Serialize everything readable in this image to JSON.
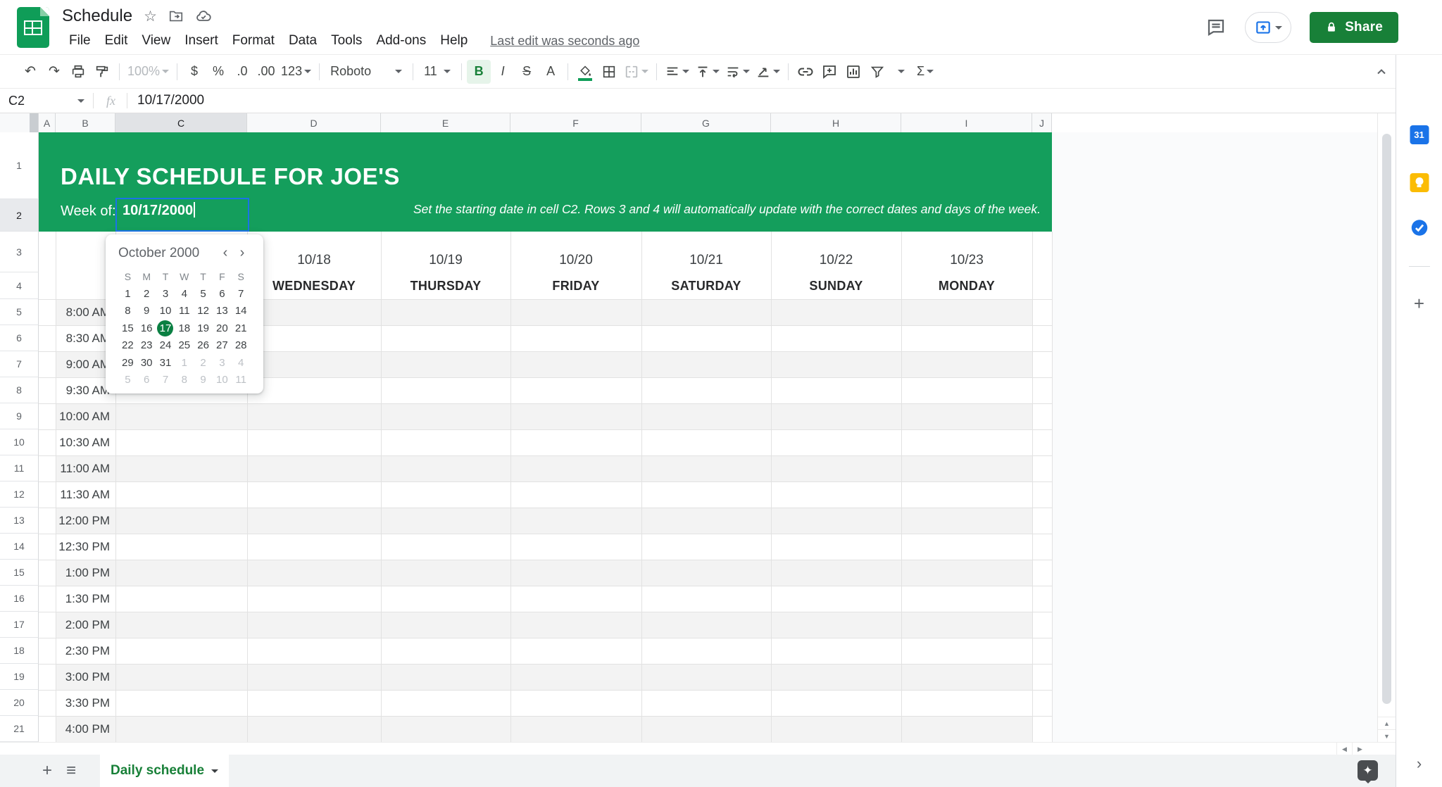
{
  "titlebar": {
    "doc_title": "Schedule",
    "menus": [
      "File",
      "Edit",
      "View",
      "Insert",
      "Format",
      "Data",
      "Tools",
      "Add-ons",
      "Help"
    ],
    "last_edit": "Last edit was seconds ago",
    "share_label": "Share"
  },
  "toolbar": {
    "zoom": "100%",
    "currency": "$",
    "percent": "%",
    "decimal_decrease": ".0",
    "decimal_increase": ".00",
    "number_format": "123",
    "font_name": "Roboto",
    "font_size": "11",
    "bold": "B",
    "italic": "I",
    "strikethrough": "S",
    "text_color": "A",
    "functions": "Σ"
  },
  "formula_bar": {
    "cell_reference": "C2",
    "fx_label": "fx",
    "value": "10/17/2000"
  },
  "grid": {
    "column_letters": [
      "A",
      "B",
      "C",
      "D",
      "E",
      "F",
      "G",
      "H",
      "I",
      "J"
    ],
    "selected_column": "C",
    "row_numbers": [
      "1",
      "2",
      "3",
      "4",
      "5",
      "6",
      "7",
      "8",
      "9",
      "10",
      "11",
      "12",
      "13",
      "14",
      "15",
      "16",
      "17",
      "18",
      "19",
      "20",
      "21"
    ],
    "selected_row": "2",
    "times": [
      "8:00 AM",
      "8:30 AM",
      "9:00 AM",
      "9:30 AM",
      "10:00 AM",
      "10:30 AM",
      "11:00 AM",
      "11:30 AM",
      "12:00 PM",
      "12:30 PM",
      "1:00 PM",
      "1:30 PM",
      "2:00 PM",
      "2:30 PM",
      "3:00 PM",
      "3:30 PM",
      "4:00 PM"
    ],
    "days": [
      {
        "date": "10/18",
        "name": "WEDNESDAY"
      },
      {
        "date": "10/19",
        "name": "THURSDAY"
      },
      {
        "date": "10/20",
        "name": "FRIDAY"
      },
      {
        "date": "10/21",
        "name": "SATURDAY"
      },
      {
        "date": "10/22",
        "name": "SUNDAY"
      },
      {
        "date": "10/23",
        "name": "MONDAY"
      }
    ]
  },
  "sheet_header": {
    "title": "DAILY SCHEDULE FOR JOE'S",
    "week_of_label": "Week of:",
    "week_of_value": "10/17/2000",
    "instruction": "Set the starting date in cell C2. Rows 3 and 4 will automatically update with the correct dates and days of the week."
  },
  "date_picker": {
    "month_label": "October 2000",
    "day_letters": [
      "S",
      "M",
      "T",
      "W",
      "T",
      "F",
      "S"
    ],
    "days": [
      {
        "d": "1"
      },
      {
        "d": "2"
      },
      {
        "d": "3"
      },
      {
        "d": "4"
      },
      {
        "d": "5"
      },
      {
        "d": "6"
      },
      {
        "d": "7"
      },
      {
        "d": "8"
      },
      {
        "d": "9"
      },
      {
        "d": "10"
      },
      {
        "d": "11"
      },
      {
        "d": "12"
      },
      {
        "d": "13"
      },
      {
        "d": "14"
      },
      {
        "d": "15"
      },
      {
        "d": "16"
      },
      {
        "d": "17",
        "selected": true
      },
      {
        "d": "18"
      },
      {
        "d": "19"
      },
      {
        "d": "20"
      },
      {
        "d": "21"
      },
      {
        "d": "22"
      },
      {
        "d": "23"
      },
      {
        "d": "24"
      },
      {
        "d": "25"
      },
      {
        "d": "26"
      },
      {
        "d": "27"
      },
      {
        "d": "28"
      },
      {
        "d": "29"
      },
      {
        "d": "30"
      },
      {
        "d": "31"
      },
      {
        "d": "1",
        "muted": true
      },
      {
        "d": "2",
        "muted": true
      },
      {
        "d": "3",
        "muted": true
      },
      {
        "d": "4",
        "muted": true
      },
      {
        "d": "5",
        "muted": true
      },
      {
        "d": "6",
        "muted": true
      },
      {
        "d": "7",
        "muted": true
      },
      {
        "d": "8",
        "muted": true
      },
      {
        "d": "9",
        "muted": true
      },
      {
        "d": "10",
        "muted": true
      },
      {
        "d": "11",
        "muted": true
      }
    ]
  },
  "bottom_bar": {
    "active_tab": "Daily schedule"
  },
  "colors": {
    "header_green": "#149e5c",
    "selected_day_green": "#0b8043",
    "share_green": "#188038",
    "tab_green": "#188038",
    "edit_border_blue": "#1a73e8",
    "band_gray": "#f3f3f3",
    "logo_green": "#0f9d58"
  }
}
